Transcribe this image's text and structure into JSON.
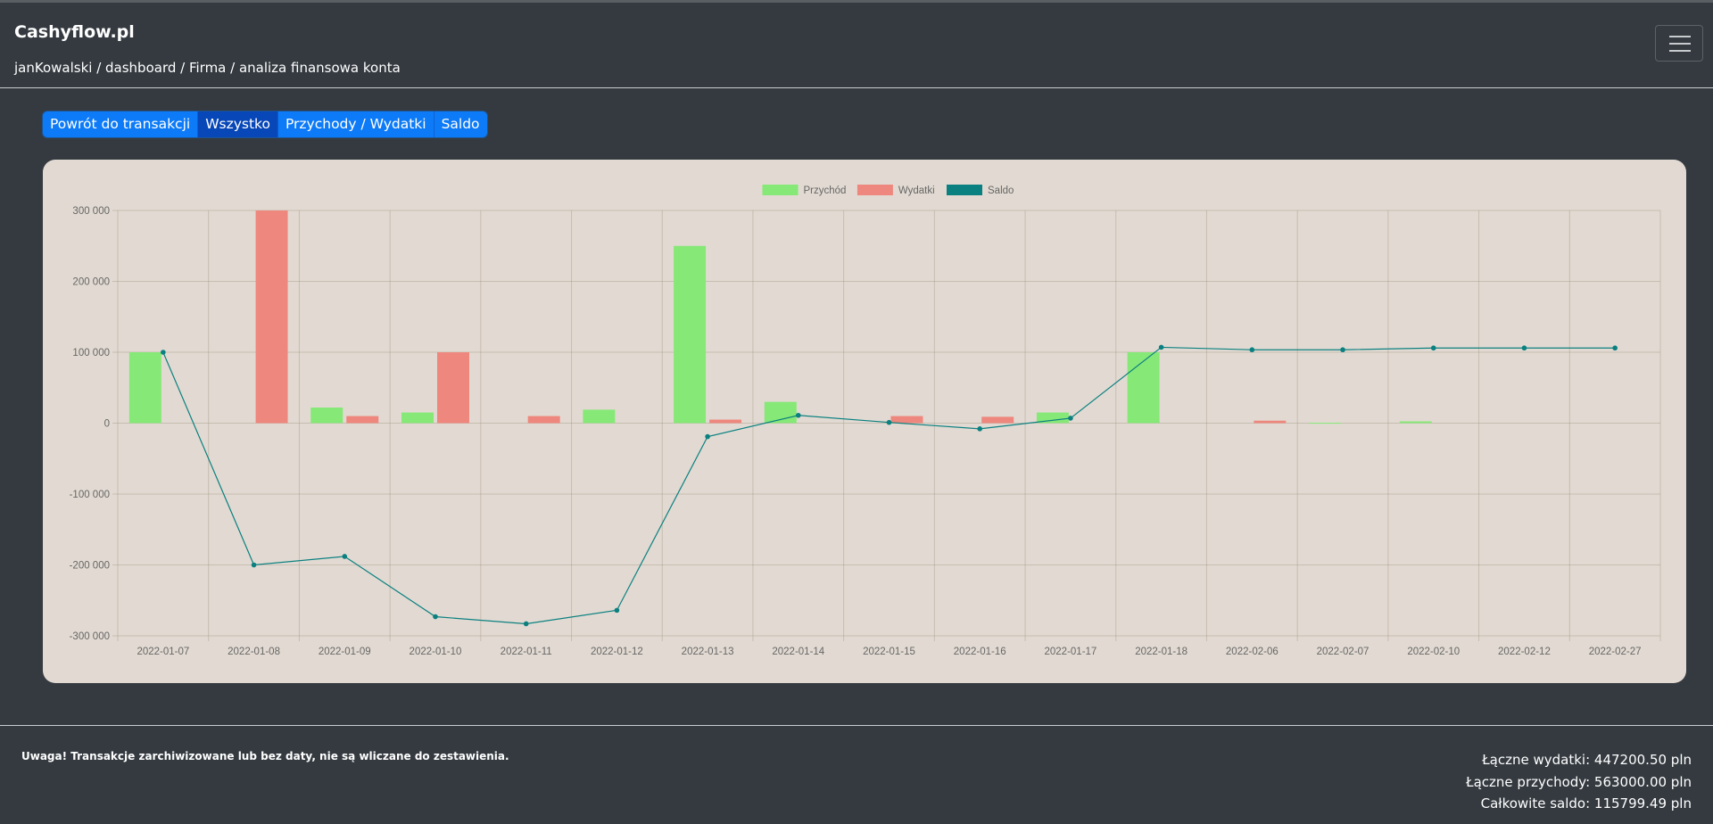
{
  "app": {
    "brand": "Cashyflow.pl",
    "breadcrumb": "janKowalski / dashboard / Firma / analiza finansowa konta"
  },
  "toolbar": {
    "buttons": [
      {
        "label": "Powrót do transakcji",
        "active": false
      },
      {
        "label": "Wszystko",
        "active": true
      },
      {
        "label": "Przychody / Wydatki",
        "active": false
      },
      {
        "label": "Saldo",
        "active": false
      }
    ]
  },
  "chart_data": {
    "type": "bar",
    "categories": [
      "2022-01-07",
      "2022-01-08",
      "2022-01-09",
      "2022-01-10",
      "2022-01-11",
      "2022-01-12",
      "2022-01-13",
      "2022-01-14",
      "2022-01-15",
      "2022-01-16",
      "2022-01-17",
      "2022-01-18",
      "2022-02-06",
      "2022-02-07",
      "2022-02-10",
      "2022-02-12",
      "2022-02-27"
    ],
    "series": [
      {
        "name": "Przychód",
        "type": "bar",
        "color": "#86e877",
        "values": [
          100000,
          0,
          22000,
          15000,
          0,
          19000,
          250000,
          30000,
          0,
          0,
          15000,
          100000,
          0,
          500,
          2500,
          0,
          0
        ]
      },
      {
        "name": "Wydatki",
        "type": "bar",
        "color": "#ee877e",
        "values": [
          0,
          300000,
          10000,
          100000,
          10000,
          0,
          5000,
          0,
          10000,
          9000,
          0,
          0,
          3500,
          0,
          0,
          0,
          0
        ]
      },
      {
        "name": "Saldo",
        "type": "line",
        "color": "#0b8080",
        "values": [
          100000,
          -200000,
          -188000,
          -273000,
          -283000,
          -264000,
          -19000,
          11000,
          1000,
          -8000,
          7000,
          107000,
          103500,
          103500,
          106000,
          106000,
          106000
        ]
      }
    ],
    "ylim": [
      -300000,
      300000
    ],
    "yticks": [
      "300 000",
      "200 000",
      "100 000",
      "0",
      "-100 000",
      "-200 000",
      "-300 000"
    ],
    "legend_position": "top-center",
    "grid": true
  },
  "footer": {
    "note": "Uwaga! Transakcje zarchiwizowane lub bez daty, nie są wliczane do zestawienia.",
    "total_expenses": "Łączne wydatki: 447200.50 pln",
    "total_income": "Łączne przychody: 563000.00 pln",
    "total_balance": "Całkowite saldo: 115799.49 pln"
  }
}
